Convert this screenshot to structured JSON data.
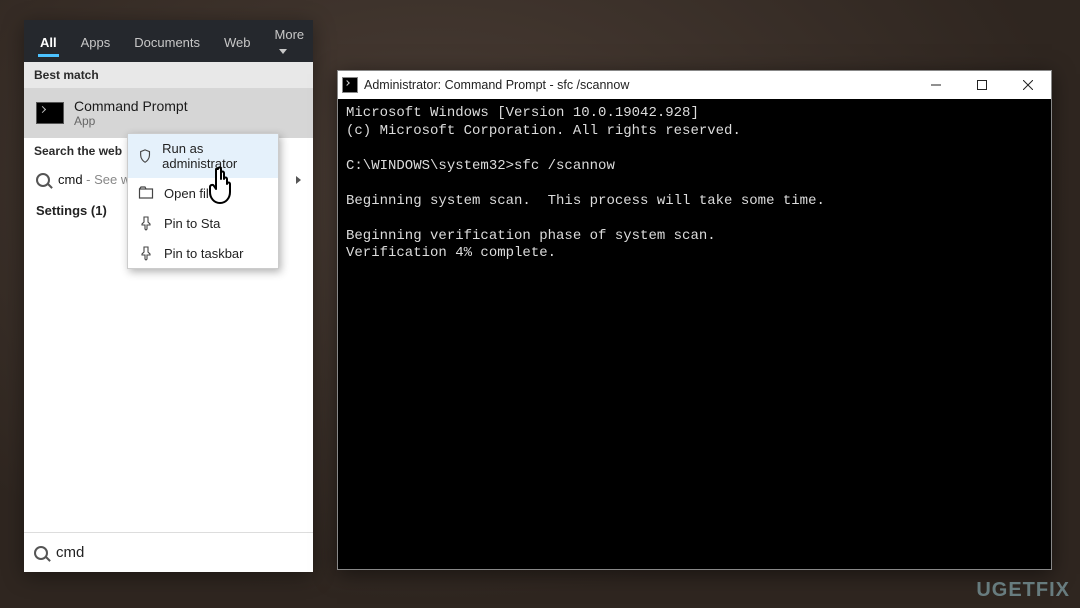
{
  "search": {
    "tabs": {
      "all": "All",
      "apps": "Apps",
      "documents": "Documents",
      "web": "Web",
      "more": "More"
    },
    "best_match_header": "Best match",
    "result": {
      "title": "Command Prompt",
      "subtitle": "App"
    },
    "search_web_header": "Search the web",
    "web_row": {
      "term": "cmd",
      "suffix": " - See we"
    },
    "settings_row": "Settings (1)",
    "input_value": "cmd"
  },
  "context_menu": {
    "run_admin": "Run as administrator",
    "open_file": "Open file",
    "pin_start": "Pin to Sta",
    "pin_taskbar": "Pin to taskbar"
  },
  "cmd_window": {
    "title": "Administrator: Command Prompt - sfc  /scannow",
    "lines": {
      "l1": "Microsoft Windows [Version 10.0.19042.928]",
      "l2": "(c) Microsoft Corporation. All rights reserved.",
      "l3": "",
      "l4": "C:\\WINDOWS\\system32>sfc /scannow",
      "l5": "",
      "l6": "Beginning system scan.  This process will take some time.",
      "l7": "",
      "l8": "Beginning verification phase of system scan.",
      "l9": "Verification 4% complete."
    }
  },
  "watermark": "UGETFIX"
}
